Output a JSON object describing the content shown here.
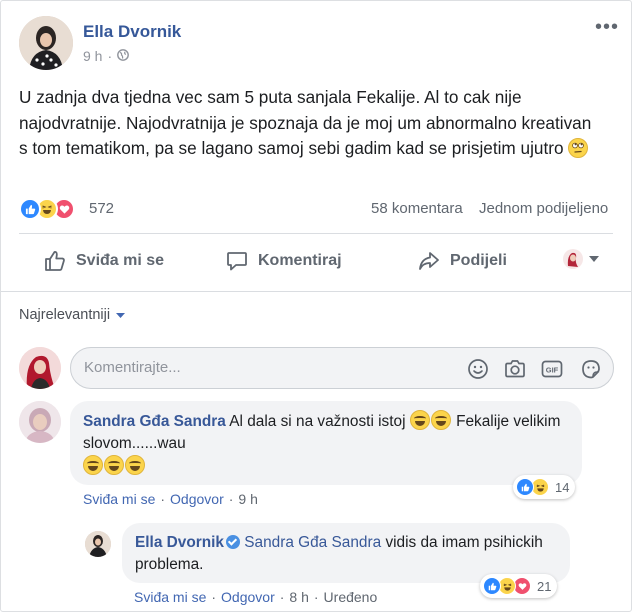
{
  "post": {
    "author": "Ella Dvornik",
    "time": "9 h",
    "separator": "·",
    "audience_icon": "globe-icon",
    "more_label": "•••",
    "text": "U zadnja dva tjedna vec sam 5 puta sanjala Fekalije. Al to cak nije najodvratnije. Najodvratnija je spoznaja da je moj um abnormalno kreativan s tom tematikom, pa se lagano samoj sebi gadim kad se prisjetim ujutro",
    "trailing_emoji": "rolling-eyes-emoji"
  },
  "stats": {
    "reaction_icons": [
      "like",
      "haha",
      "love"
    ],
    "reaction_count": "572",
    "comments": "58 komentara",
    "shares": "Jednom podijeljeno"
  },
  "actions": {
    "like": "Sviđa mi se",
    "comment": "Komentiraj",
    "share": "Podijeli"
  },
  "comments_section": {
    "sort_label": "Najrelevantniji",
    "composer_placeholder": "Komentirajte...",
    "comments": [
      {
        "author": "Sandra Gđa Sandra",
        "text_part1": "Al dala si na važnosti istoj",
        "text_part2": "Fekalije velikim slovom......wau",
        "reactions": [
          "like",
          "haha"
        ],
        "reaction_count": "14",
        "like_label": "Sviđa mi se",
        "reply_label": "Odgovor",
        "time": "9 h"
      },
      {
        "author": "Ella Dvornik",
        "mention": "Sandra Gđa Sandra",
        "text": "vidis da imam psihickih problema.",
        "reactions": [
          "like",
          "haha",
          "love"
        ],
        "reaction_count": "21",
        "like_label": "Sviđa mi se",
        "reply_label": "Odgovor",
        "time": "8 h",
        "edited_label": "Uređeno"
      }
    ]
  },
  "colors": {
    "name_blue": "#365899",
    "link_blue": "#4267b2",
    "like_blue": "#2d88ff",
    "haha_yellow": "#fbd44b",
    "love_red": "#f0506e",
    "meta_gray": "#606770"
  }
}
